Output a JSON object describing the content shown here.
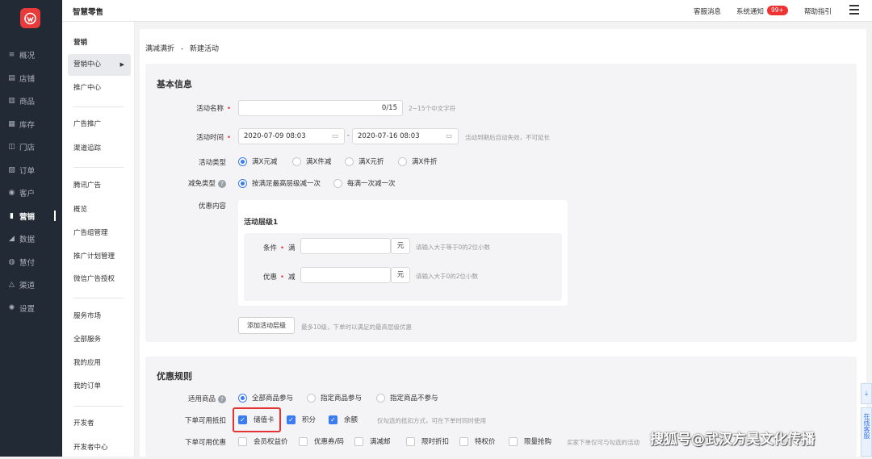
{
  "app": {
    "title": "智慧零售"
  },
  "topbar": {
    "service": "客服消息",
    "notice": "系统通知",
    "badge": "99+",
    "help": "帮助指引"
  },
  "leftnav": [
    {
      "icon": "overview-icon",
      "glyph": "≡",
      "label": "概况"
    },
    {
      "icon": "shop-icon",
      "glyph": "▤",
      "label": "店铺"
    },
    {
      "icon": "goods-icon",
      "glyph": "▥",
      "label": "商品"
    },
    {
      "icon": "inventory-icon",
      "glyph": "▦",
      "label": "库存"
    },
    {
      "icon": "store-icon",
      "glyph": "◫",
      "label": "门店"
    },
    {
      "icon": "order-icon",
      "glyph": "▧",
      "label": "订单"
    },
    {
      "icon": "customer-icon",
      "glyph": "◉",
      "label": "客户"
    },
    {
      "icon": "marketing-icon",
      "glyph": "▮",
      "label": "营销",
      "active": true
    },
    {
      "icon": "data-icon",
      "glyph": "◢",
      "label": "数据"
    },
    {
      "icon": "pay-icon",
      "glyph": "◍",
      "label": "慧付"
    },
    {
      "icon": "channel-icon",
      "glyph": "△",
      "label": "渠道"
    },
    {
      "icon": "settings-icon",
      "glyph": "✺",
      "label": "设置"
    }
  ],
  "subnav": {
    "g1": "营销",
    "s1": "营销中心",
    "s2": "推广中心",
    "g2": "广告推广",
    "s3": "渠道追踪",
    "g3": "腾讯广告",
    "s4": "概览",
    "s5": "广告组管理",
    "s6": "推广计划管理",
    "s7": "微信广告授权",
    "g4": "服务市场",
    "s8": "全部服务",
    "s9": "我的应用",
    "s10": "我的订单",
    "g5": "开发者",
    "s11": "开发者中心"
  },
  "breadcrumb": {
    "parent": "满减满折",
    "sep": "-",
    "current": "新建活动"
  },
  "basic": {
    "title": "基本信息",
    "name_label": "活动名称",
    "name_counter": "0/15",
    "name_hint": "2~15个中文字符",
    "time_label": "活动时间",
    "start": "2020-07-09 08:03",
    "dash": "-",
    "end": "2020-07-16 08:03",
    "time_hint": "活动到期后自动失效，不可延长",
    "type_label": "活动类型",
    "types": [
      "满X元减",
      "满X件减",
      "满X元折",
      "满X件折"
    ],
    "reduce_label": "减免类型",
    "reduces": [
      "按满足最高层级减一次",
      "每满一次减一次"
    ],
    "content_label": "优惠内容",
    "level_title": "活动层级1",
    "cond_label": "条件",
    "cond_prefix": "满",
    "cond_unit": "元",
    "cond_hint": "请输入大于等于0的2位小数",
    "disc_label": "优惠",
    "disc_prefix": "减",
    "disc_unit": "元",
    "disc_hint": "请输入大于0的2位小数",
    "add_btn": "添加活动层级",
    "add_hint": "最多10级，下单时以满足的最高层级优惠"
  },
  "rules": {
    "title": "优惠规则",
    "goods_label": "适用商品",
    "goods": [
      "全部商品参与",
      "指定商品参与",
      "指定商品不参与"
    ],
    "deduct_label": "下单可用抵扣",
    "deducts": [
      "储值卡",
      "积分",
      "余额"
    ],
    "deduct_hint": "仅勾选的抵扣方式，可在下单时同时使用",
    "promo_label": "下单可用优惠",
    "promos": [
      "会员权益价",
      "优惠券/码",
      "满减邮",
      "限时折扣",
      "特权价",
      "限量抢购"
    ],
    "promo_hint": "买家下单仅可与勾选的活动"
  },
  "watermark": "搜狐号@武汉方昊文化传播",
  "edge": {
    "chat": "在线客服"
  },
  "colors": {
    "accent": "#3b7cf0",
    "sidebar": "#222a35",
    "danger": "#e33333"
  }
}
